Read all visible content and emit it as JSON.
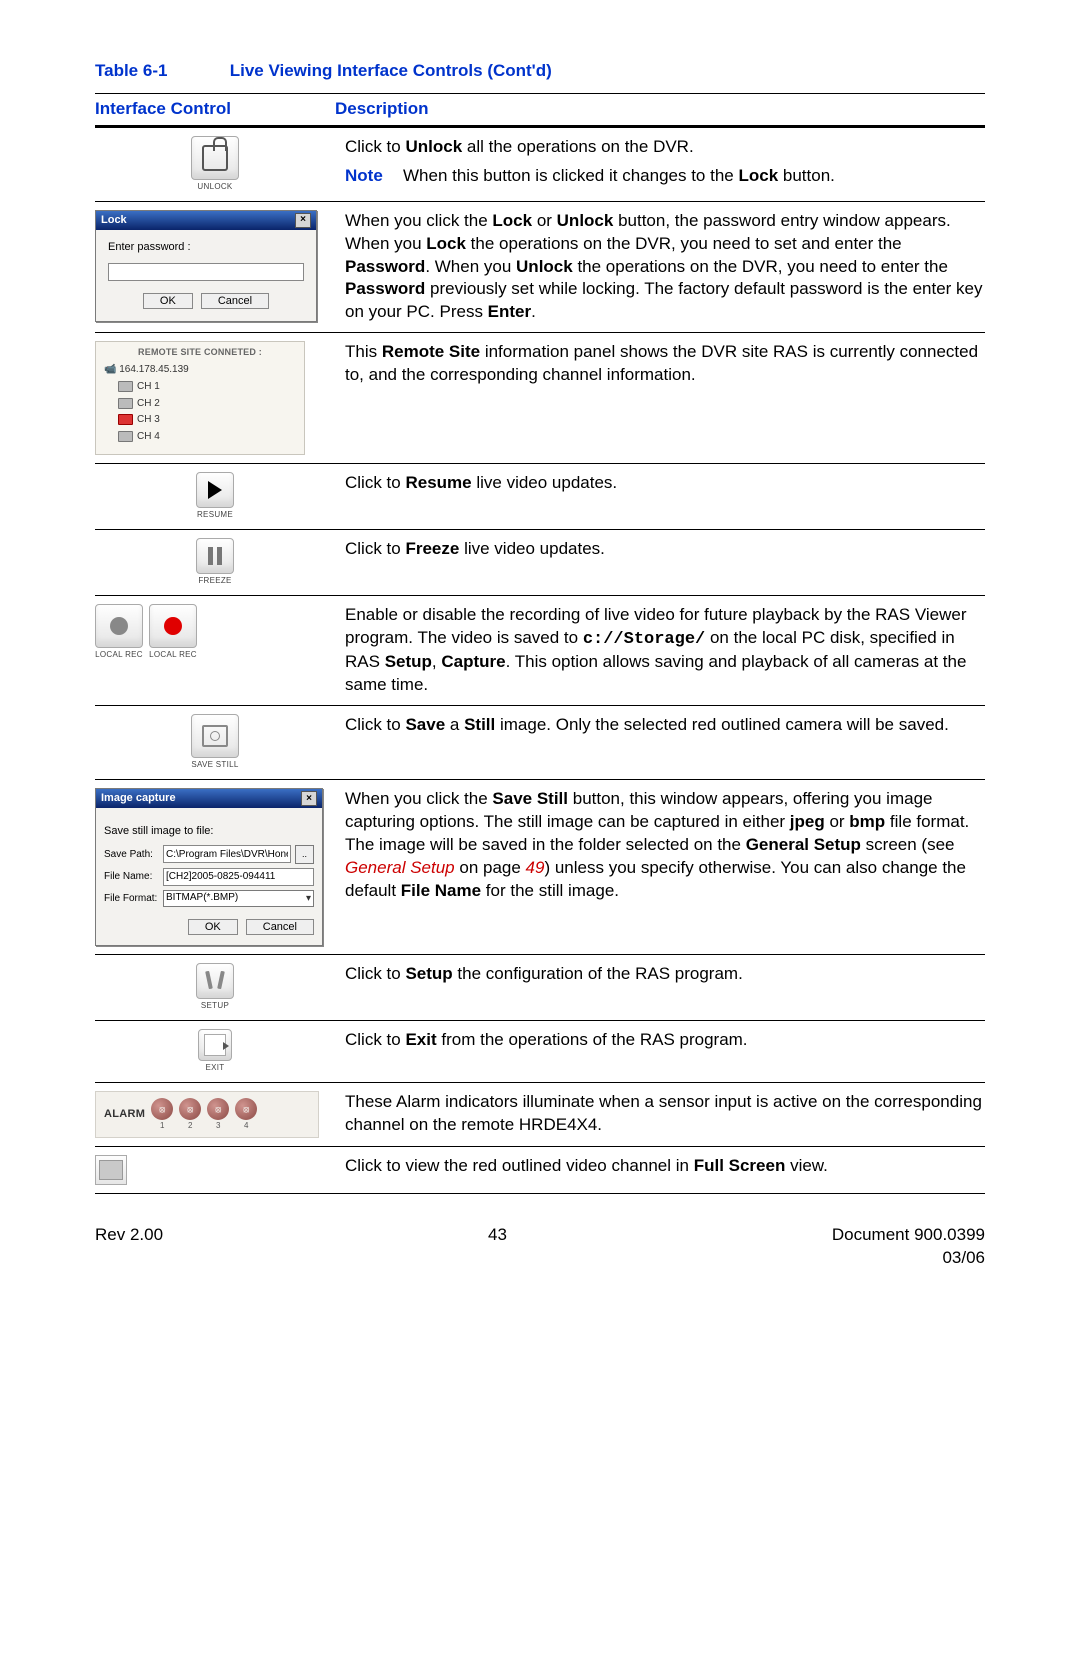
{
  "table": {
    "number": "Table 6-1",
    "title": "Live Viewing Interface Controls  (Cont'd)",
    "col1": "Interface Control",
    "col2": "Description"
  },
  "row_unlock": {
    "caption": "UNLOCK",
    "desc_p1a": "Click to ",
    "desc_p1b": "Unlock",
    "desc_p1c": " all the operations on the DVR.",
    "note_label": "Note",
    "note_a": "When this button is clicked it changes to the ",
    "note_b": "Lock",
    "note_c": " button."
  },
  "row_lockdlg": {
    "win_title": "Lock",
    "prompt": "Enter password :",
    "ok": "OK",
    "cancel": "Cancel",
    "d1": "When you click the ",
    "d2": "Lock",
    "d3": " or ",
    "d4": "Unlock",
    "d5": " button, the password entry window appears. When you ",
    "d6": "Lock",
    "d7": " the operations on the DVR, you need to set and enter the ",
    "d8": "Password",
    "d9": ". When you ",
    "d10": "Unlock",
    "d11": " the operations on the DVR, you need to enter the ",
    "d12": "Password",
    "d13": " previously set while locking. The factory default password is the enter key on your PC. Press ",
    "d14": "Enter",
    "d15": "."
  },
  "row_remote": {
    "hdr": "REMOTE SITE CONNETED :",
    "ip": "164.178.45.139",
    "ch1": "CH 1",
    "ch2": "CH 2",
    "ch3": "CH 3",
    "ch4": "CH 4",
    "d1": "This ",
    "d2": "Remote Site",
    "d3": " information panel shows the DVR site RAS is currently connected to, and the corresponding channel information."
  },
  "row_resume": {
    "caption": "RESUME",
    "d1": "Click to ",
    "d2": "Resume",
    "d3": " live video updates."
  },
  "row_freeze": {
    "caption": "FREEZE",
    "d1": "Click to ",
    "d2": "Freeze",
    "d3": " live video updates."
  },
  "row_rec": {
    "caption": "LOCAL REC",
    "d1": "Enable or disable the recording of live video for future playback by the RAS Viewer program. The video is saved to ",
    "d2": "c://Storage/",
    "d3": " on the local PC disk, specified in RAS ",
    "d4": "Setup",
    "d5": ", ",
    "d6": "Capture",
    "d7": ". This option allows saving and playback of all cameras at the same time."
  },
  "row_savestill": {
    "caption": "SAVE STILL",
    "d1": "Click to ",
    "d2": "Save",
    "d3": " a ",
    "d4": "Still",
    "d5": " image. Only the selected red outlined camera will be saved."
  },
  "row_capdlg": {
    "title": "Image capture",
    "prompt": "Save still image to file:",
    "l1": "Save Path:",
    "v1": "C:\\Program Files\\DVR\\Honeyw",
    "l2": "File Name:",
    "v2": "[CH2]2005-0825-094411",
    "l3": "File Format:",
    "v3": "BITMAP(*.BMP)",
    "ok": "OK",
    "cancel": "Cancel",
    "d1": "When you click the ",
    "d2": "Save Still",
    "d3": " button, this window appears, offering you image capturing options. The still image can be captured in either ",
    "d4": "jpeg",
    "d5": " or ",
    "d6": "bmp",
    "d7": " file format. The image will be saved in the folder selected on the ",
    "d8": "General Setup",
    "d9": " screen (see ",
    "d10": "General Setup",
    "d11": " on page ",
    "d12": "49",
    "d13": ") unless you specify otherwise. You can also change the default ",
    "d14": "File Name",
    "d15": " for the still image."
  },
  "row_setup": {
    "caption": "SETUP",
    "d1": "Click to ",
    "d2": "Setup",
    "d3": " the configuration of the RAS program."
  },
  "row_exit": {
    "caption": "EXIT",
    "d1": "Click to ",
    "d2": "Exit",
    "d3": " from the operations of the RAS program."
  },
  "row_alarm": {
    "label": "ALARM",
    "n1": "1",
    "n2": "2",
    "n3": "3",
    "n4": "4",
    "d1": "These Alarm indicators illuminate when a sensor input is active on the corresponding channel on the remote HRDE4X4."
  },
  "row_full": {
    "d1": "Click to view the red outlined video channel in ",
    "d2": "Full Screen",
    "d3": " view."
  },
  "footer": {
    "left": "Rev 2.00",
    "mid": "43",
    "right1": "Document 900.0399",
    "right2": "03/06"
  }
}
